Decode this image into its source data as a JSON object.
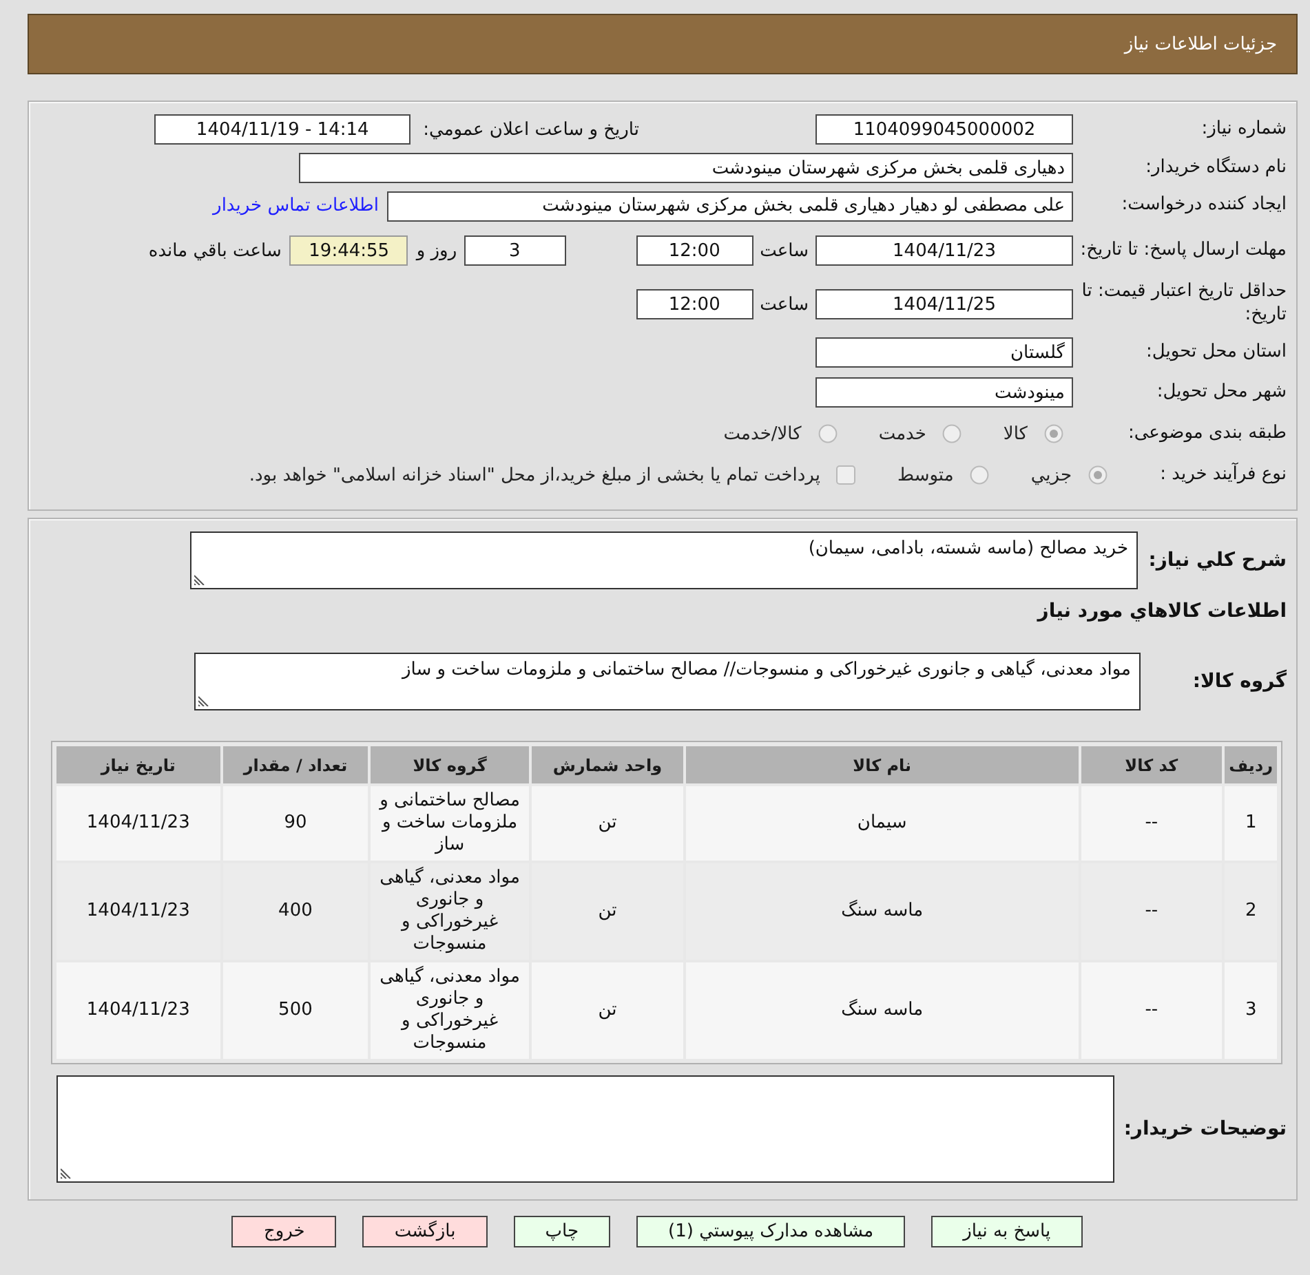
{
  "header": {
    "title": "جزئیات اطلاعات نیاز"
  },
  "details": {
    "need_number": {
      "label": "شماره نیاز:",
      "value": "1104099045000002"
    },
    "announcement": {
      "label": "تاريخ و ساعت اعلان عمومي:",
      "value": "1404/11/19 - 14:14"
    },
    "buyer_org": {
      "label": "نام دستگاه خریدار:",
      "value": "دهیاری قلمی بخش مرکزی شهرستان مینودشت"
    },
    "requester": {
      "label": "ایجاد کننده درخواست:",
      "value": "علی مصطفی لو دهیار دهیاری قلمی بخش مرکزی شهرستان مینودشت",
      "link": "اطلاعات تماس خریدار"
    },
    "reply_deadline": {
      "label": "مهلت ارسال پاسخ: تا تاریخ:",
      "date": "1404/11/23",
      "time_label": "ساعت",
      "time": "12:00",
      "days": "3",
      "days_label": "روز و",
      "remaining": "19:44:55",
      "remaining_label": "ساعت باقي مانده"
    },
    "price_validity": {
      "label": "حداقل تاریخ اعتبار قیمت: تا تاریخ:",
      "date": "1404/11/25",
      "time_label": "ساعت",
      "time": "12:00"
    },
    "province": {
      "label": "استان محل تحویل:",
      "value": "گلستان"
    },
    "city": {
      "label": "شهر محل تحویل:",
      "value": "مینودشت"
    },
    "category": {
      "label": "طبقه بندی موضوعی:",
      "options": [
        {
          "label": "کالا",
          "selected": true,
          "disabled": true
        },
        {
          "label": "خدمت",
          "selected": false,
          "disabled": true
        },
        {
          "label": "کالا/خدمت",
          "selected": false,
          "disabled": true
        }
      ]
    },
    "process": {
      "label": "نوع فرآیند خرید :",
      "options": [
        {
          "label": "جزيي",
          "selected": true,
          "disabled": true
        },
        {
          "label": "متوسط",
          "selected": false,
          "disabled": true
        }
      ],
      "treasury": {
        "label": "پرداخت تمام یا بخشی از مبلغ خرید،از محل \"اسناد خزانه اسلامی\" خواهد بود.",
        "checked": false,
        "disabled": true
      }
    }
  },
  "needs": {
    "summary": {
      "label": "شرح كلي نياز:",
      "value": "خرید مصالح (ماسه شسته، بادامی، سیمان)"
    },
    "section_title": "اطلاعات كالاهاي مورد نياز",
    "goods_group": {
      "label": "گروه کالا:",
      "value": "مواد معدنی، گیاهی و جانوری غیرخوراکی و منسوجات// مصالح ساختمانی و ملزومات ساخت و ساز"
    },
    "table": {
      "columns": [
        "ردیف",
        "کد کالا",
        "نام کالا",
        "واحد شمارش",
        "گروه کالا",
        "تعداد / مقدار",
        "تاریخ نیاز"
      ],
      "rows": [
        [
          "1",
          "--",
          "سیمان",
          "تن",
          "مصالح ساختمانی و ملزومات ساخت و ساز",
          "90",
          "1404/11/23"
        ],
        [
          "2",
          "--",
          "ماسه سنگ",
          "تن",
          "مواد معدنی، گیاهی و جانوری غیرخوراکی و منسوجات",
          "400",
          "1404/11/23"
        ],
        [
          "3",
          "--",
          "ماسه سنگ",
          "تن",
          "مواد معدنی، گیاهی و جانوری غیرخوراکی و منسوجات",
          "500",
          "1404/11/23"
        ]
      ]
    },
    "buyer_notes": {
      "label": "توضیحات خریدار:"
    }
  },
  "buttons": [
    {
      "label": "پاسخ به نیاز",
      "kind": "action"
    },
    {
      "label": "مشاهده مدارک پیوستي (1)",
      "kind": "action"
    },
    {
      "label": "چاپ",
      "kind": "action"
    },
    {
      "label": "بازگشت",
      "kind": "exit"
    },
    {
      "label": "خروج",
      "kind": "exit"
    }
  ]
}
